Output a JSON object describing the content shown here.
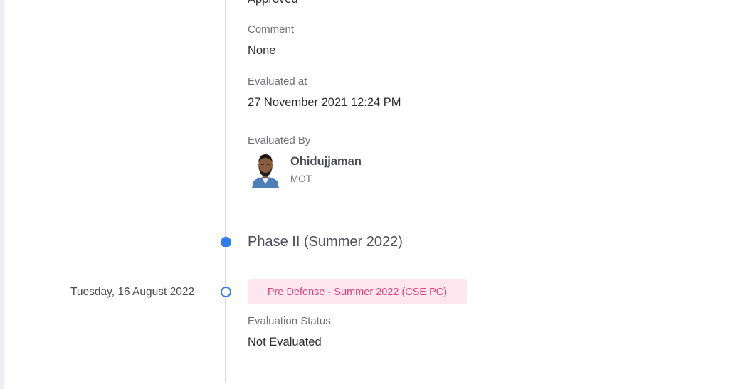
{
  "evaluation_prev": {
    "status_value": "Approved",
    "comment_label": "Comment",
    "comment_value": "None",
    "evaluated_at_label": "Evaluated at",
    "evaluated_at_value": "27 November 2021 12:24 PM",
    "evaluated_by_label": "Evaluated By",
    "evaluator": {
      "name": "Ohidujjaman",
      "role": "MOT",
      "avatar_icon": "user-photo"
    }
  },
  "phase": {
    "title": "Phase II (Summer 2022)"
  },
  "event": {
    "date": "Tuesday, 16 August 2022",
    "badge": "Pre Defense - Summer 2022 (CSE PC)",
    "status_label": "Evaluation Status",
    "status_value": "Not Evaluated"
  },
  "colors": {
    "accent": "#2f7bf0",
    "badge_bg": "#fde7ee",
    "badge_text": "#e83d78"
  }
}
